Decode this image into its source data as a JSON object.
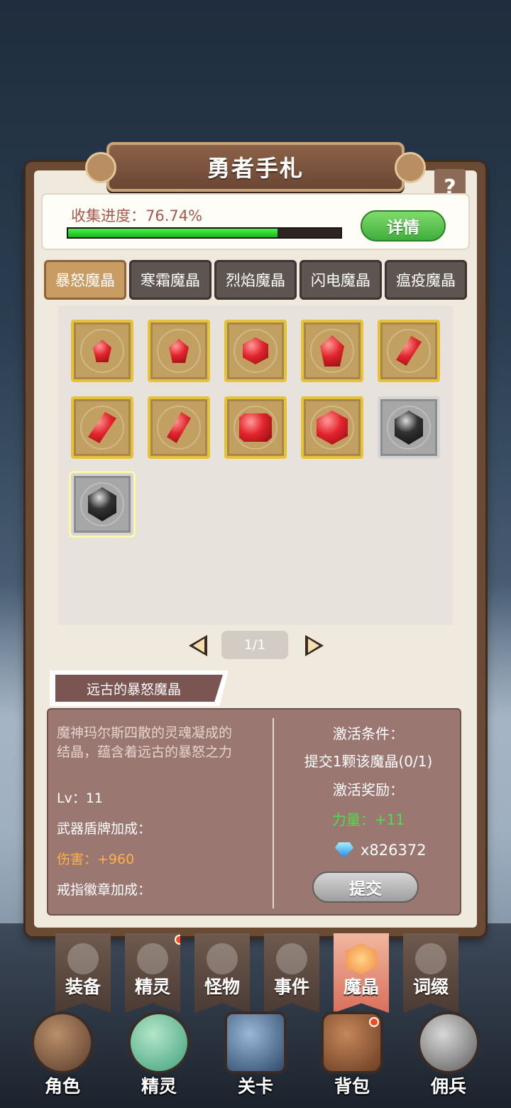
{
  "title": "勇者手札",
  "help": "?",
  "progress": {
    "label": "收集进度：76.74%",
    "fraction": 0.7674,
    "detail_button": "详情"
  },
  "tabs": [
    {
      "label": "暴怒魔晶",
      "active": true
    },
    {
      "label": "寒霜魔晶",
      "active": false
    },
    {
      "label": "烈焰魔晶",
      "active": false
    },
    {
      "label": "闪电魔晶",
      "active": false
    },
    {
      "label": "瘟疫魔晶",
      "active": false
    }
  ],
  "crystals": [
    {
      "icon": "red-crystal-icon",
      "state": "collected"
    },
    {
      "icon": "red-crystal-icon",
      "state": "collected"
    },
    {
      "icon": "red-crystal-icon",
      "state": "collected"
    },
    {
      "icon": "red-crystal-icon",
      "state": "collected"
    },
    {
      "icon": "red-crystal-icon",
      "state": "collected"
    },
    {
      "icon": "red-crystal-icon",
      "state": "collected"
    },
    {
      "icon": "red-crystal-icon",
      "state": "collected"
    },
    {
      "icon": "red-crystal-icon",
      "state": "collected"
    },
    {
      "icon": "red-crystal-icon",
      "state": "collected"
    },
    {
      "icon": "black-crystal-icon",
      "state": "locked"
    },
    {
      "icon": "black-crystal-icon",
      "state": "locked-selected"
    }
  ],
  "pager": {
    "text": "1/1"
  },
  "item": {
    "name": "远古的暴怒魔晶",
    "description_line1": "魔神玛尔斯四散的灵魂凝成的",
    "description_line2": "结晶，蕴含着远古的暴怒之力",
    "level": "Lv：11",
    "weapon_bonus_label": "武器盾牌加成：",
    "damage": "伤害：+960",
    "ring_bonus_label": "戒指徽章加成："
  },
  "activation": {
    "condition_label": "激活条件：",
    "condition": "提交1颗该魔晶(0/1)",
    "reward_label": "激活奖励：",
    "reward": "力量：+11",
    "gems": "x826372",
    "submit_button": "提交"
  },
  "category_nav": [
    {
      "label": "装备",
      "icon": "helmet-icon",
      "active": false,
      "dot": false
    },
    {
      "label": "精灵",
      "icon": "spirit-icon",
      "active": false,
      "dot": true
    },
    {
      "label": "怪物",
      "icon": "dragon-icon",
      "active": false,
      "dot": false
    },
    {
      "label": "事件",
      "icon": "scroll-icon",
      "active": false,
      "dot": false
    },
    {
      "label": "魔晶",
      "icon": "crystal-icon",
      "active": true,
      "dot": false
    },
    {
      "label": "词缀",
      "icon": "swirl-icon",
      "active": false,
      "dot": false
    }
  ],
  "main_nav": [
    {
      "label": "角色",
      "icon": "hero-avatar-icon"
    },
    {
      "label": "精灵",
      "icon": "slime-spirit-icon"
    },
    {
      "label": "关卡",
      "icon": "stage-portal-icon"
    },
    {
      "label": "背包",
      "icon": "backpack-icon"
    },
    {
      "label": "佣兵",
      "icon": "knight-helmet-icon"
    }
  ],
  "colors": {
    "accent_green": "#4ce04c",
    "damage_orange": "#ffb04a",
    "active_tab": "#c99c63",
    "notification": "#ff4a1c"
  }
}
